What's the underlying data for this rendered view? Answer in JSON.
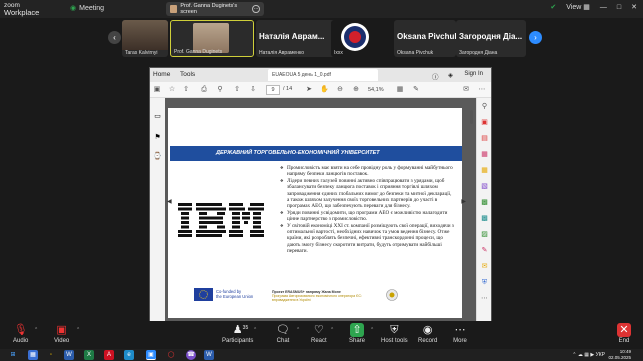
{
  "app": {
    "logo_line1": "zoom",
    "logo_line2": "Workplace",
    "meeting_label": "Meeting",
    "share_tab_label": "Prof. Ganna Duginets's screen",
    "view_label": "View"
  },
  "participants": [
    {
      "name": "Taras Kalvirnyi",
      "big": ""
    },
    {
      "name": "Prof. Ganna Duginets",
      "big": ""
    },
    {
      "name": "Наталія Авраменко",
      "big": "Наталія Аврам..."
    },
    {
      "name": "Ixxx",
      "big": ""
    },
    {
      "name": "Oksana Pivchuk",
      "big": "Oksana Pivchuk"
    },
    {
      "name": "Загородня Діана",
      "big": "Загородня Діа..."
    }
  ],
  "pdf": {
    "menu_home": "Home",
    "menu_tools": "Tools",
    "doc_tab": "EUAEOUA 5 день 1_0.pdf",
    "sign_in": "Sign In",
    "page_current": "9",
    "page_total": "/ 14",
    "zoom": "54,1%"
  },
  "slide": {
    "header": "ДЕРЖАВНИЙ ТОРГОВЕЛЬНО-ЕКОНОМІЧНИЙ УНІВЕРСИТЕТ",
    "bullets": [
      "Промисловість має взяти на себе провідну роль у формуванні майбутнього напряму безпеки ланцюгів поставок.",
      "Лідери певних галузей повинні активно співпрацювати з урядами, щоб збалансувати безпеку ланцюга поставок і сприяння торгівлі шляхом запровадження єдиних глобальних вимог до безпеки та митної декларації, а також шляхом залучення своїх торговельних партнерів до участі в програмах AEO, що забезпечують переваги для бізнесу.",
      "Уряди повинні усвідомити, що програми AEO є можливістю налагодити цінне партнерство з промисловістю.",
      "У світовій економіці XXI ст. компанії розміщують свої операції, виходячи з оптимальної вартості, необхідних навичок та умов ведення бізнесу. Отже країни, які розроблять безпечні, ефективні транскордонні процеси, що дають змогу бізнесу скоротити витрати, будуть отримувати найбільші переваги."
    ],
    "eu_line1": "Co-funded by",
    "eu_line2": "the European Union",
    "project_line1": "Проект ERASMUS+ напряму Жана Моне",
    "project_line2": "Програма Авторизованого економічного оператора ЄС:",
    "project_line3": "впровадження в Україні"
  },
  "controls": {
    "audio": "Audio",
    "video": "Video",
    "participants": "Participants",
    "participants_count": "35",
    "chat": "Chat",
    "react": "React",
    "share": "Share",
    "host_tools": "Host tools",
    "record": "Record",
    "more": "More",
    "end": "End"
  },
  "taskbar": {
    "lang": "УКР",
    "time": "10:49",
    "date": "02.05.2025"
  },
  "colors": {
    "slide_header": "#1f4e9e",
    "share_green": "#2ea44f",
    "end_red": "#d33333",
    "nav_blue": "#2d8cff"
  }
}
